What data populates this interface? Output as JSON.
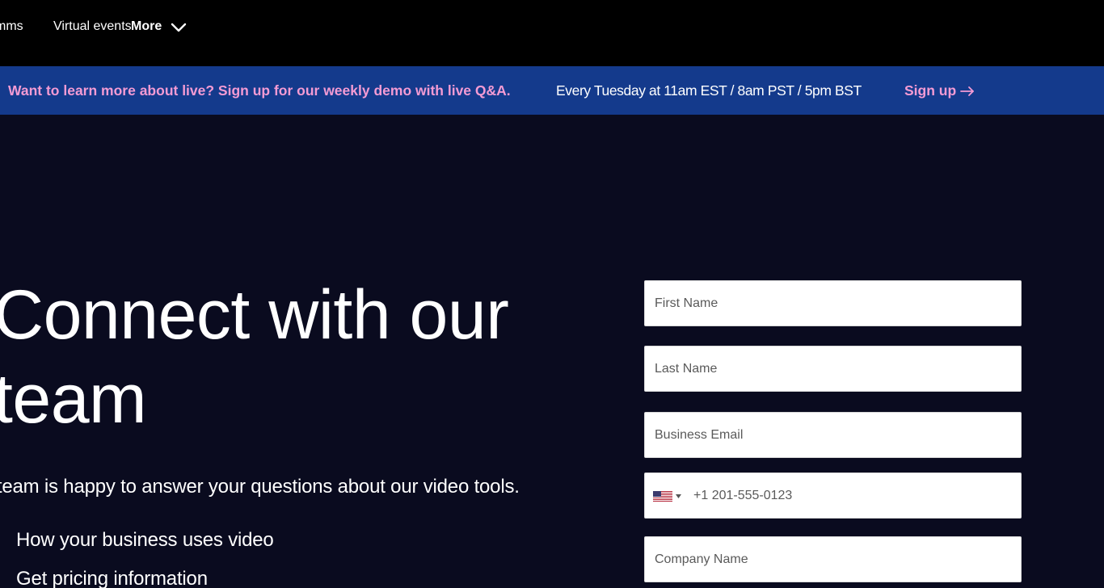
{
  "nav": {
    "items": [
      "mms",
      "Virtual events"
    ],
    "more_label": "More"
  },
  "banner": {
    "promo_text": "Want to learn more about live? Sign up for our weekly demo with live Q&A.",
    "schedule_text": "Every Tuesday at 11am EST / 8am PST / 5pm BST",
    "signup_label": "Sign up",
    "background_color": "#143a8c",
    "accent_color": "#f49bd4"
  },
  "hero": {
    "title": "Connect with our team",
    "subtitle": "Our team is happy to answer your questions about our video tools.",
    "list": [
      "How your business uses video",
      "Get pricing information"
    ]
  },
  "form": {
    "first_name_placeholder": "First Name",
    "last_name_placeholder": "Last Name",
    "email_placeholder": "Business Email",
    "phone_placeholder": "+1 201-555-0123",
    "phone_country": "us-flag-icon",
    "company_placeholder": "Company Name"
  }
}
